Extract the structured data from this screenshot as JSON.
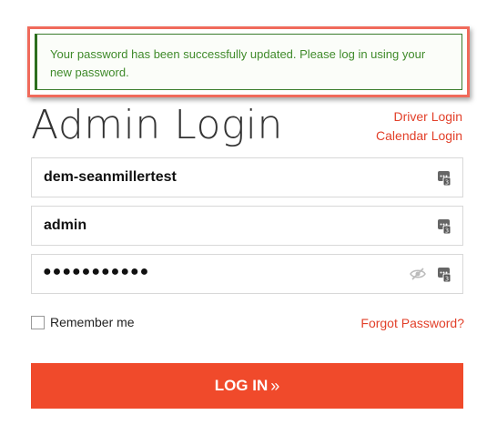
{
  "alert": {
    "message": "Your password has been successfully updated. Please log in using your new password."
  },
  "header": {
    "title": "Admin Login",
    "driver_login": "Driver Login",
    "calendar_login": "Calendar Login"
  },
  "form": {
    "username_value": "dem-seanmillertest",
    "email_value": "admin",
    "password_masked": "●●●●●●●●●●●",
    "remember_label": "Remember me",
    "forgot_label": "Forgot Password?",
    "login_label": "LOG IN",
    "login_arrows": "»"
  },
  "icons": {
    "field_icon": "password-manager-key-icon",
    "reveal_icon": "eye-slash-icon"
  },
  "colors": {
    "accent": "#f04a2b",
    "link": "#e2402a",
    "success_text": "#3f8a2a"
  }
}
